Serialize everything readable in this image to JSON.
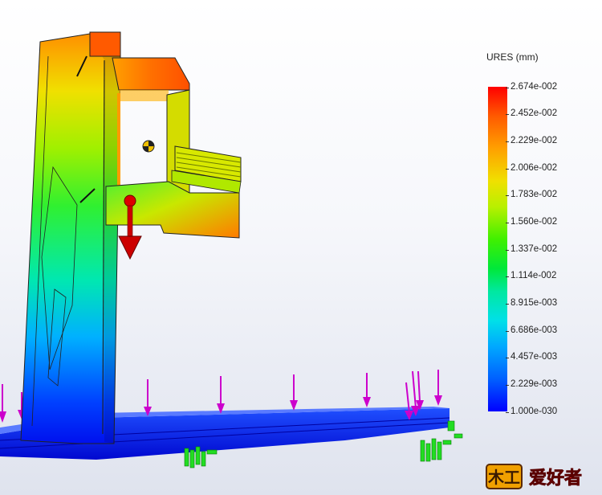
{
  "legend": {
    "title": "URES (mm)",
    "ticks": [
      "2.674e-002",
      "2.452e-002",
      "2.229e-002",
      "2.006e-002",
      "1.783e-002",
      "1.560e-002",
      "1.337e-002",
      "1.114e-002",
      "8.915e-003",
      "6.686e-003",
      "4.457e-003",
      "2.229e-003",
      "1.000e-030"
    ]
  },
  "colors": {
    "max": "#ff0000",
    "min": "#0000ff",
    "load_arrow": "#cc0000",
    "fixture": "#22dd22",
    "distributed_load": "#cc00cc"
  },
  "watermark": {
    "text": "木工爱好者"
  }
}
